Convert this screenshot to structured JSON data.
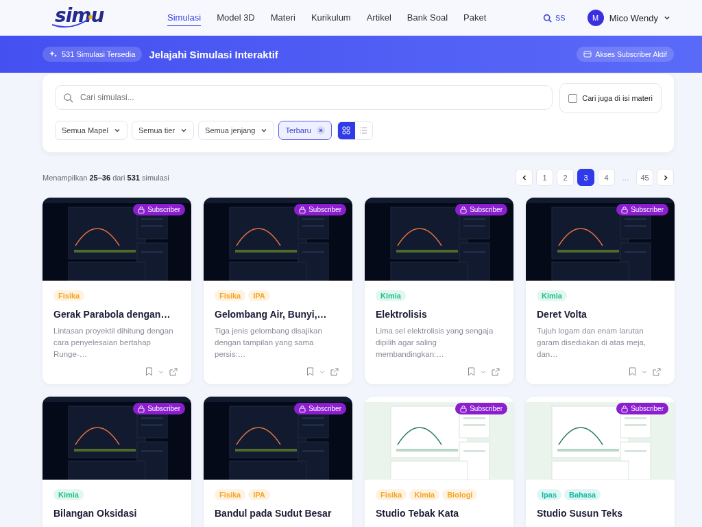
{
  "header": {
    "logo": "simu",
    "nav": [
      {
        "label": "Simulasi",
        "selected": true
      },
      {
        "label": "Model 3D",
        "selected": false
      },
      {
        "label": "Materi",
        "selected": false
      },
      {
        "label": "Kurikulum",
        "selected": false
      },
      {
        "label": "Artikel",
        "selected": false
      },
      {
        "label": "Bank Soal",
        "selected": false
      },
      {
        "label": "Paket",
        "selected": false
      }
    ],
    "search_label": "SS",
    "user": {
      "initial": "M",
      "name": "Mico Wendy"
    }
  },
  "banner": {
    "count_badge": "531 Simulasi Tersedia",
    "title": "Jelajahi Simulasi Interaktif",
    "access_badge": "Akses Subscriber Aktif"
  },
  "filters": {
    "search": {
      "placeholder": "Cari simulasi..."
    },
    "content_search": {
      "label": "Cari juga di isi materi",
      "checked": false
    },
    "dropdowns": [
      "Semua Mapel",
      "Semua tier",
      "Semua jenjang"
    ],
    "sort_chip": "Terbaru",
    "views": [
      {
        "kind": "grid",
        "selected": true
      },
      {
        "kind": "list",
        "selected": false
      }
    ]
  },
  "summary": "Menampilkan **25–36** dari **531** simulasi",
  "pagination": [
    {
      "label": "1",
      "selected": false
    },
    {
      "label": "2",
      "selected": false
    },
    {
      "label": "3",
      "selected": true
    },
    {
      "label": "4",
      "selected": false
    },
    {
      "label": "…",
      "kind": "gap"
    },
    {
      "label": "45",
      "selected": false
    }
  ],
  "cards": [
    {
      "kind": "dark",
      "badge": "Subscriber",
      "tags": [
        {
          "label": "Fisika",
          "color": "#f5a524"
        }
      ],
      "title": "Gerak Parabola dengan…",
      "description": "Lintasan proyektil dihitung dengan cara penyelesaian bertahap Runge-…"
    },
    {
      "kind": "dark",
      "badge": "Subscriber",
      "tags": [
        {
          "label": "Fisika",
          "color": "#f5a524"
        },
        {
          "label": "IPA",
          "color": "#f5a524"
        }
      ],
      "title": "Gelombang Air, Bunyi,…",
      "description": "Tiga jenis gelombang disajikan dengan tampilan yang sama persis:…"
    },
    {
      "kind": "dark",
      "badge": "Subscriber",
      "tags": [
        {
          "label": "Kimia",
          "color": "#22c08a"
        }
      ],
      "title": "Elektrolisis",
      "description": "Lima sel elektrolisis yang sengaja dipilih agar saling membandingkan:…"
    },
    {
      "kind": "dark",
      "badge": "Subscriber",
      "tags": [
        {
          "label": "Kimia",
          "color": "#22c08a"
        }
      ],
      "title": "Deret Volta",
      "description": "Tujuh logam dan enam larutan garam disediakan di atas meja, dan…"
    },
    {
      "kind": "dark",
      "badge": "Subscriber",
      "tags": [
        {
          "label": "Kimia",
          "color": "#22c08a"
        }
      ],
      "title": "Bilangan Oksidasi"
    },
    {
      "kind": "dark",
      "badge": "Subscriber",
      "tags": [
        {
          "label": "Fisika",
          "color": "#f5a524"
        },
        {
          "label": "IPA",
          "color": "#f5a524"
        }
      ],
      "title": "Bandul pada Sudut Besar"
    },
    {
      "kind": "light",
      "badge": "Subscriber",
      "tags": [
        {
          "label": "Fisika",
          "color": "#f5a524"
        },
        {
          "label": "Kimia",
          "color": "#f5a524"
        },
        {
          "label": "Biologi",
          "color": "#f5a524"
        }
      ],
      "title": "Studio Tebak Kata"
    },
    {
      "kind": "light",
      "badge": "Subscriber",
      "tags": [
        {
          "label": "Ipas",
          "color": "#14b8a6"
        },
        {
          "label": "Bahasa",
          "color": "#14b8a6"
        }
      ],
      "title": "Studio Susun Teks"
    }
  ]
}
